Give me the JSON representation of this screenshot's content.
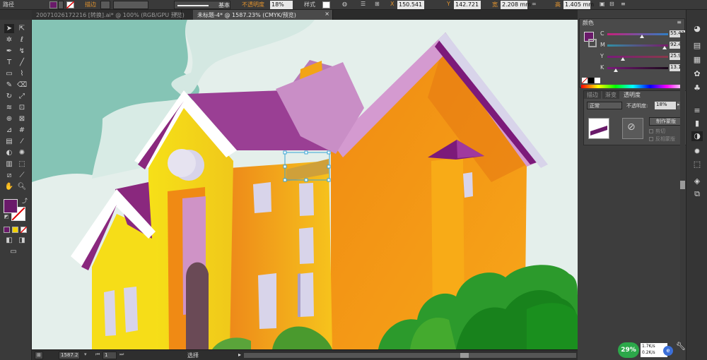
{
  "control_bar": {
    "tool_label": "路径",
    "stroke_label": "描边",
    "stroke_profile": "基本",
    "opacity_label": "不透明度",
    "opacity_value": "18%",
    "style_label": "样式",
    "x_value": "150.541",
    "y_value": "142.721",
    "width_label": "宽",
    "width_value": "2.208 mm",
    "height_label": "高",
    "height_value": "1.405 mm",
    "fill_color": "#6a1a6a"
  },
  "tabs": [
    {
      "label": "20071026172216 [转换].ai* @ 100% (RGB/GPU 预览)",
      "active": false
    },
    {
      "label": "未标题-4* @ 1587.23% (CMYK/预览)",
      "active": true
    }
  ],
  "color_panel": {
    "title": "颜色",
    "channels": [
      {
        "label": "C",
        "value": "55.42"
      },
      {
        "label": "M",
        "value": "92.41"
      },
      {
        "label": "Y",
        "value": "25.97"
      },
      {
        "label": "K",
        "value": "13.1"
      }
    ],
    "fill": "#6a1a6a"
  },
  "transparency_panel": {
    "tabs": [
      "描边",
      "渐变",
      "透明度"
    ],
    "blend_mode": "正常",
    "opacity_label": "不透明度:",
    "opacity_value": "18%",
    "make_mask_button": "制作蒙版",
    "clip_label": "剪切",
    "invert_mask_label": "反相蒙版"
  },
  "status_bar": {
    "zoom": "1587.2",
    "page": "1",
    "tool_status": "选择"
  },
  "net_widget": {
    "percent": "29%",
    "upload": "1.7K/s",
    "download": "0.2K/s"
  }
}
